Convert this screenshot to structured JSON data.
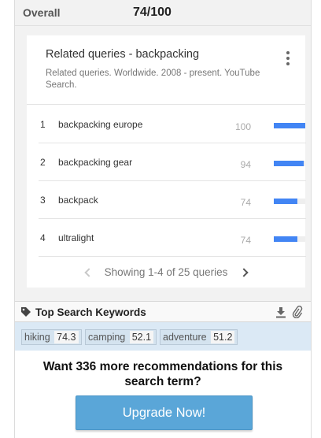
{
  "overall": {
    "label": "Overall",
    "score": "74/100"
  },
  "related": {
    "title": "Related queries - backpacking",
    "subtitle": "Related queries. Worldwide. 2008 - present. YouTube Search.",
    "rows": [
      {
        "rank": "1",
        "query": "backpacking europe",
        "value": "100",
        "bar_fraction": 1.0
      },
      {
        "rank": "2",
        "query": "backpacking gear",
        "value": "94",
        "bar_fraction": 0.94
      },
      {
        "rank": "3",
        "query": "backpack",
        "value": "74",
        "bar_fraction": 0.74
      },
      {
        "rank": "4",
        "query": "ultralight",
        "value": "74",
        "bar_fraction": 0.74
      }
    ],
    "pager_text": "Showing 1-4 of 25 queries"
  },
  "keywords": {
    "title": "Top Search Keywords",
    "chips": [
      {
        "word": "hiking",
        "score": "74.3"
      },
      {
        "word": "camping",
        "score": "52.1"
      },
      {
        "word": "adventure",
        "score": "51.2"
      }
    ]
  },
  "recommend": {
    "text": "Want 336 more recommendations for this search term?",
    "button_label": "Upgrade Now!"
  },
  "colors": {
    "bar": "#4285f4",
    "button": "#5aa6d8",
    "keyword_bg": "#dbe9f5"
  },
  "icons": [
    "more-vert-icon",
    "chevron-left-icon",
    "chevron-right-icon",
    "tag-icon",
    "download-icon",
    "paperclip-icon"
  ]
}
